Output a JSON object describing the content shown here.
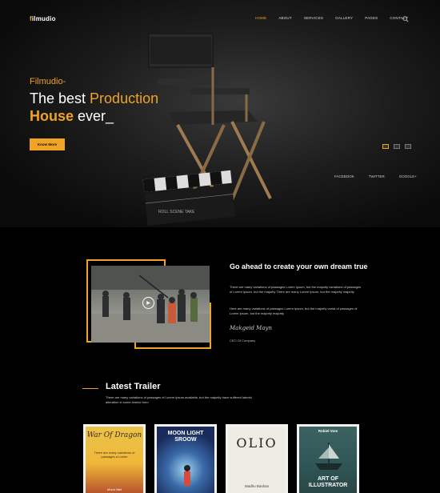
{
  "logo": {
    "accent": "f",
    "rest": "ilmudio"
  },
  "nav": {
    "items": [
      "HOME",
      "ABOUT",
      "SERVICES",
      "GALLERY",
      "PAGES",
      "CONTACT"
    ]
  },
  "hero": {
    "brand": "Filmudio-",
    "line1_a": "The best ",
    "line1_b": "Production",
    "line2_a": "House",
    "line2_b": " ever_",
    "button": "Know More",
    "clapper_text": "ROLL   SCENE   TAKE"
  },
  "social": [
    "FACEBOOK",
    "TWITTER",
    "GOOGLE+"
  ],
  "about": {
    "title": "Go ahead to create your own dream true",
    "p1": "There are many variations of passages Lorem Ipsum, but the majority variations of passages of Lorem Ipsum, but the majority There are many Lorem Ipsum, but the majority majority",
    "p2": "Here are many variations of passages Lorem Ipsum, but the majority variat of passages of Lorem Ipsum, but the majority majority",
    "signature": "Makgeid  Mayn",
    "role": "CEO Of Company"
  },
  "trailer": {
    "title": "Latest Trailer",
    "text": "There are many variations of passages of Lorem Ipsum available, but the majority have suffered labmid alteration in some ledmid form"
  },
  "posters": [
    {
      "title": "War Of Dragon",
      "sub": "There are many variations of passages a Lorem",
      "author": "Moon Niel"
    },
    {
      "title": "MOON LIGHT SROOW",
      "sub": "",
      "author": ""
    },
    {
      "title": "OLIO",
      "sub": "",
      "author": "Madhu Bashan"
    },
    {
      "title": "ART OF ILLUSTRATOR",
      "sub": "",
      "author": "Robiel Vom"
    }
  ],
  "colors": {
    "accent": "#f0a324",
    "bg": "#000000"
  }
}
